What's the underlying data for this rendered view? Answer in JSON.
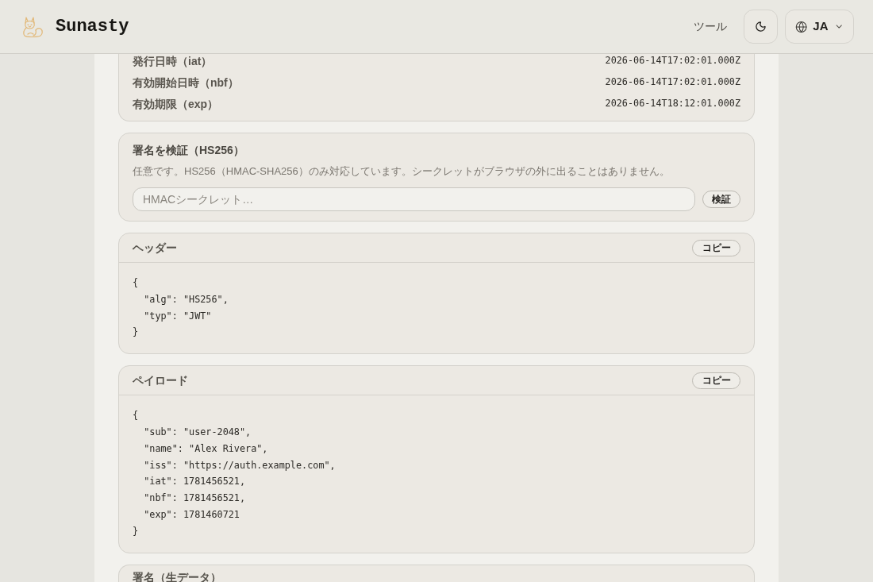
{
  "header": {
    "brand": "Sunasty",
    "nav": [
      {
        "label": "ツール"
      }
    ],
    "language": "JA"
  },
  "claims": [
    {
      "label": "発行日時（iat）",
      "value": "2026-06-14T17:02:01.000Z"
    },
    {
      "label": "有効開始日時（nbf）",
      "value": "2026-06-14T17:02:01.000Z"
    },
    {
      "label": "有効期限（exp）",
      "value": "2026-06-14T18:12:01.000Z"
    }
  ],
  "verify": {
    "title": "署名を検証（HS256）",
    "description": "任意です。HS256（HMAC-SHA256）のみ対応しています。シークレットがブラウザの外に出ることはありません。",
    "placeholder": "HMACシークレット…",
    "button": "検証"
  },
  "sections": [
    {
      "title": "ヘッダー",
      "button": "コピー",
      "lines": [
        "{",
        "  \"alg\": \"HS256\",",
        "  \"typ\": \"JWT\"",
        "}"
      ]
    },
    {
      "title": "ペイロード",
      "button": "コピー",
      "lines": [
        "{",
        "  \"sub\": \"user-2048\",",
        "  \"name\": \"Alex Rivera\",",
        "  \"iss\": \"https://auth.example.com\",",
        "  \"iat\": 1781456521,",
        "  \"nbf\": 1781456521,",
        "  \"exp\": 1781460721",
        "}"
      ]
    },
    {
      "title": "署名（生データ）"
    }
  ]
}
